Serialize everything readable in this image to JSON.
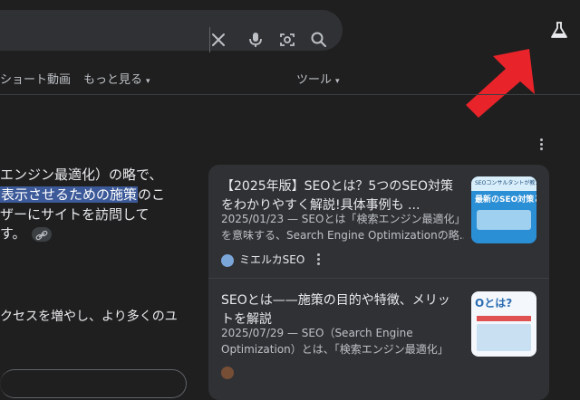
{
  "header": {
    "clear_icon": "close-icon",
    "voice_icon": "mic-icon",
    "lens_icon": "camera-lens-icon",
    "search_icon": "search-icon",
    "labs_icon": "flask-icon"
  },
  "tabs": [
    {
      "label": "ショート動画"
    },
    {
      "label": "もっと見る"
    },
    {
      "label": "ツール"
    }
  ],
  "answer": {
    "line1": "エンジン最適化）の略で、",
    "line2_pre": "表示させるための施策",
    "line2_post": "のこ",
    "line3": "ザーにサイトを訪問して",
    "line4": "す。",
    "para2": "クセスを増やし、より多くのユ"
  },
  "sources": [
    {
      "title": "【2025年版】SEOとは？5つのSEO対策をわかりやすく解説!具体事例も ...",
      "snippet1": "2025/01/23 — SEOとは「検索エンジン最適化」",
      "snippet2": "を意味する、Search Engine Optimizationの略...",
      "site": "ミエルカSEO",
      "thumb_line1": "SEOコンサルタントが教える",
      "thumb_line2": "最新のSEO対策とは"
    },
    {
      "title": "SEOとは——施策の目的や特徴、メリットを解説",
      "snippet1": "2025/07/29 — SEO（Search Engine",
      "snippet2": "Optimization）とは、「検索エンジン最適化」",
      "site": "",
      "thumb_line1": "Oとは?"
    }
  ],
  "colors": {
    "background": "#1f1f1f",
    "card": "#303134",
    "highlight": "#3c5a99",
    "arrow": "#e8232a"
  }
}
